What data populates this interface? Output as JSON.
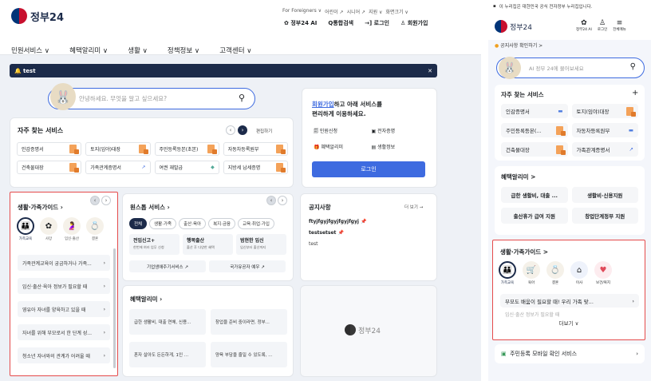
{
  "desktop": {
    "logo_text": "정부24",
    "util_links": [
      "For Foreigners ∨",
      "어린이 ↗",
      "시니어 ↗",
      "지원 ∨",
      "화면크기 ∨"
    ],
    "top_actions": {
      "ai": "정부24 AI",
      "search": "통합검색",
      "login": "로그인",
      "signup": "회원가입"
    },
    "gnb": [
      "민원서비스 ∨",
      "혜택알리미 ∨",
      "생활 ∨",
      "정책정보 ∨",
      "고객센터 ∨"
    ],
    "alert_text": "test",
    "search_placeholder": "안녕하세요. 무엇을 알고 싶으세요?",
    "freq": {
      "title": "자주 찾는 서비스",
      "edit": "편집하기",
      "items": [
        "인감증명서",
        "토지(임야)대장",
        "주민등록등본(초본)",
        "자동차등록원부",
        "건축물대장",
        "가족관계증명서",
        "여권 재발급",
        "지방세 납세증명"
      ]
    },
    "login_box": {
      "signup_link": "회원가입",
      "line1_rest": "하고 아래 서비스를",
      "line2": "편리하게 이용하세요.",
      "items": [
        "민원신청",
        "전자증명",
        "혜택알리미",
        "생활정보"
      ],
      "button": "로그인"
    },
    "life": {
      "title": "생활·가족가이드",
      "cats": [
        "가족교육",
        "사망",
        "임신·출산",
        "결혼"
      ],
      "items": [
        "가족관계교육이 궁금하거나 가족...",
        "임신·출산·육아 정보가 필요할 때",
        "영유아 자녀를 양육하고 있을 때",
        "자녀를 위해 부모로서 한 단계 성...",
        "청소년 자녀와의 관계가 어려울 때"
      ]
    },
    "onestop": {
      "title": "원스톱 서비스",
      "tabs": [
        "전체",
        "생활·가족",
        "출산·육아",
        "복지·금융",
        "교육·취업·가입"
      ],
      "cards": [
        {
          "title": "전입신고+",
          "desc": "한번에 여러 업무 신청"
        },
        {
          "title": "행복출산",
          "desc": "출산 후 다양한 혜택"
        },
        {
          "title": "범현한 임신",
          "desc": "임신부터 출산까지"
        }
      ],
      "links": [
        "기업생애주기서비스 ↗",
        "국가유공자 예우 ↗"
      ]
    },
    "notice": {
      "title": "공지사항",
      "more": "더 보기 →",
      "items": [
        "ftyjfgyjfgyjfgyjfgyj",
        "testsetset",
        "test"
      ]
    },
    "benefit": {
      "title": "혜택알리미",
      "items": [
        "급한 생활비, 대출 연체, 신용...",
        "창업을 준비 중이라면, 정부...",
        "혼자 살아도 든든하게, 1인 ...",
        "양육 부담을 줄일 수 있도록, ..."
      ]
    },
    "banner_logo": "정부24"
  },
  "mobile": {
    "notice_bar": "이 누리집은 대한민국 공식 전자정부 누리집입니다.",
    "logo_text": "정부24",
    "header_icons": [
      "정부24 AI",
      "로그인",
      "전체메뉴"
    ],
    "announce": "공지사항 확인하기 >",
    "search_placeholder": "AI 정부 24에 물어보세요",
    "freq": {
      "title": "자주 찾는 서비스",
      "items": [
        "인감증명서",
        "토지(임야)대장",
        "주민등록등본(...",
        "자동차등록원부",
        "건축물대장",
        "가족관계증명서"
      ]
    },
    "benefit": {
      "title": "혜택알리미 >",
      "items": [
        "급한 생활비, 대출 ...",
        "생활비·신용지원",
        "출산휴가 급여 지원",
        "창업단계정부 지원"
      ]
    },
    "life": {
      "title": "생활·가족가이드 >",
      "cats": [
        "가족교육",
        "육아",
        "결혼",
        "이사",
        "보건/복지"
      ],
      "item": "부모도 배움이 필요할 때! 우리 가족 맞...",
      "item2": "임신·출산 정보가 필요할 때",
      "more": "더보기 ∨"
    },
    "bottom_service": "주민등록 모바일 확인 서비스"
  }
}
